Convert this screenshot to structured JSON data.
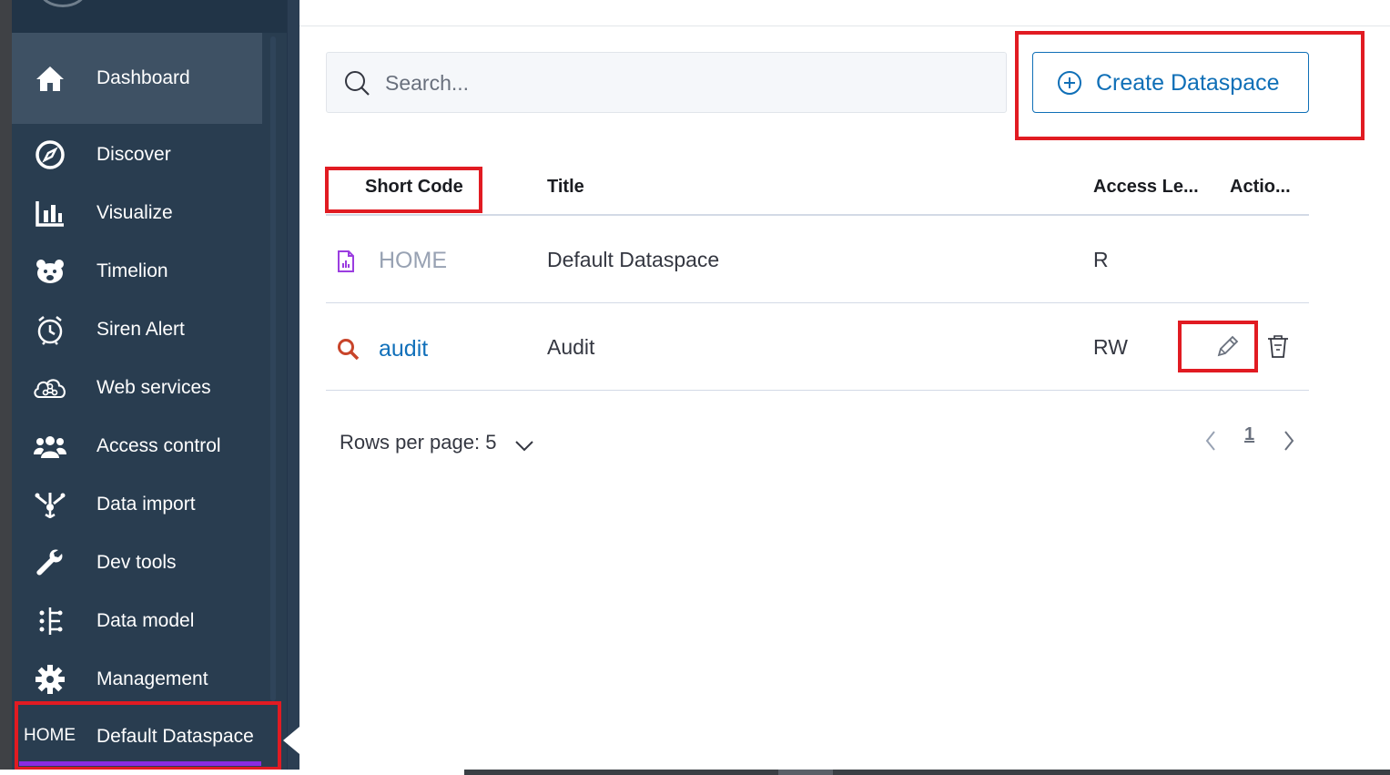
{
  "sidebar": {
    "items": [
      {
        "label": "Dashboard",
        "icon": "home-icon"
      },
      {
        "label": "Discover",
        "icon": "compass-icon"
      },
      {
        "label": "Visualize",
        "icon": "bar-chart-icon"
      },
      {
        "label": "Timelion",
        "icon": "bear-icon"
      },
      {
        "label": "Siren Alert",
        "icon": "alarm-clock-icon"
      },
      {
        "label": "Web services",
        "icon": "cloud-network-icon"
      },
      {
        "label": "Access control",
        "icon": "users-icon"
      },
      {
        "label": "Data import",
        "icon": "import-icon"
      },
      {
        "label": "Dev tools",
        "icon": "wrench-icon"
      },
      {
        "label": "Data model",
        "icon": "data-model-icon"
      },
      {
        "label": "Management",
        "icon": "gear-icon"
      }
    ],
    "active_item": "Dashboard",
    "dataspace": {
      "code": "HOME",
      "title": "Default Dataspace"
    }
  },
  "main": {
    "search": {
      "placeholder": "Search..."
    },
    "create_button": "Create Dataspace",
    "table": {
      "headers": [
        "Short Code",
        "Title",
        "Access Le...",
        "Actio..."
      ],
      "rows": [
        {
          "code": "HOME",
          "title": "Default Dataspace",
          "access": "R",
          "icon": "document-chart-icon"
        },
        {
          "code": "audit",
          "title": "Audit",
          "access": "RW",
          "icon": "search-icon"
        }
      ]
    },
    "pagination": {
      "rows_per_page": "Rows per page: 5",
      "current_page": "1"
    }
  },
  "colors": {
    "sidebar_bg": "#293d50",
    "accent": "#0f6fb7",
    "highlight_box": "#e11b22",
    "dataspace_underline": "#8a2be2"
  }
}
